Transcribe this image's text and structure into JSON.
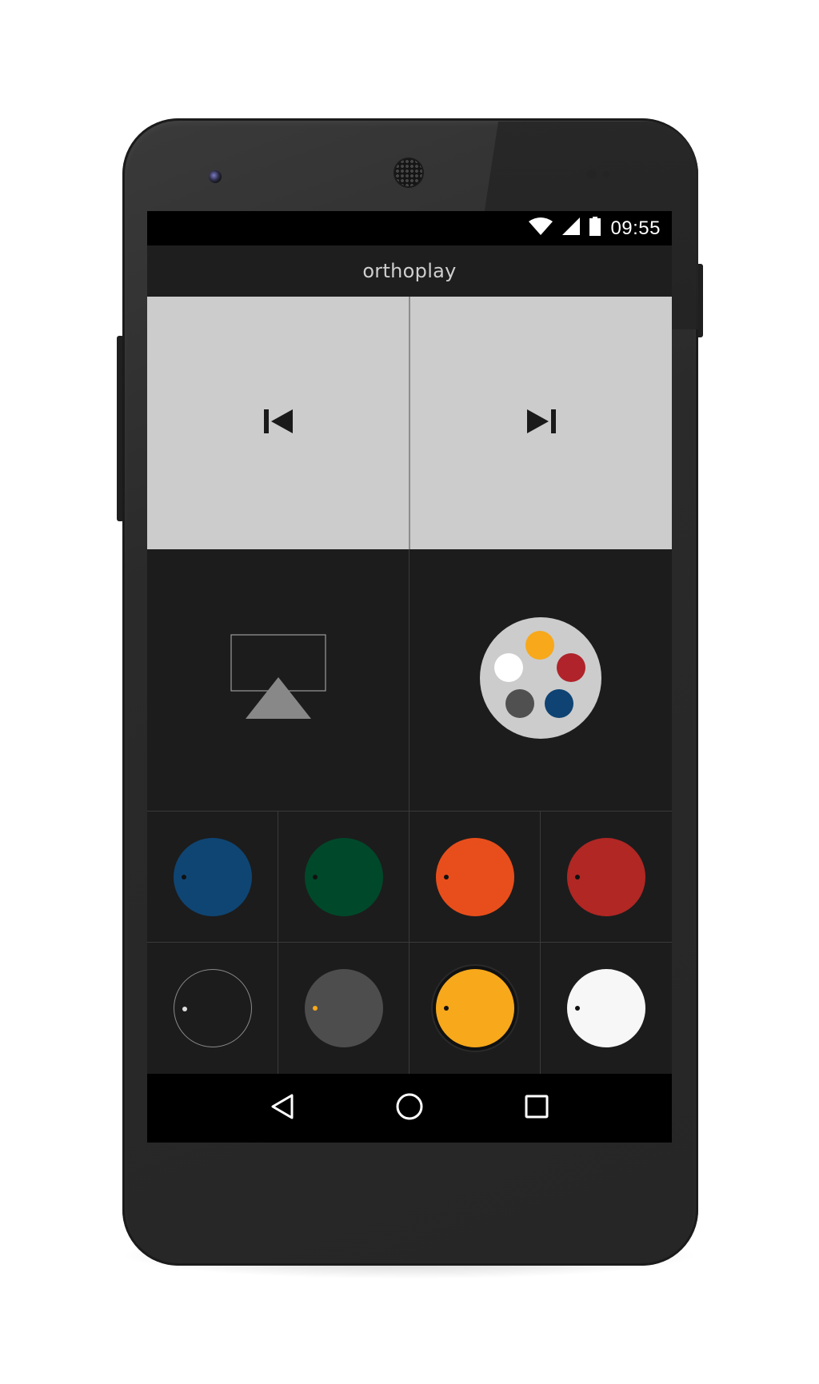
{
  "status_bar": {
    "time": "09:55",
    "icons": [
      "wifi-icon",
      "cell-signal-icon",
      "battery-icon"
    ]
  },
  "app": {
    "title": "orthoplay"
  },
  "media_controls": {
    "previous": {
      "icon": "skip-previous-icon"
    },
    "next": {
      "icon": "skip-next-icon"
    }
  },
  "actions": {
    "airplay": {
      "icon": "airplay-icon"
    },
    "palette": {
      "icon": "color-palette-icon",
      "colors": [
        "#F7A81B",
        "#FFFFFF",
        "#B0232A",
        "#505050",
        "#0E4373"
      ]
    }
  },
  "swatches": [
    {
      "color": "#0F4573",
      "dot": "#111111",
      "style": "filled",
      "selected": false
    },
    {
      "color": "#00482A",
      "dot": "#111111",
      "style": "filled",
      "selected": false
    },
    {
      "color": "#E84E1B",
      "dot": "#111111",
      "style": "filled",
      "selected": false
    },
    {
      "color": "#B02724",
      "dot": "#111111",
      "style": "filled",
      "selected": false
    },
    {
      "color": "#1C1C1C",
      "dot": "#DDDDDD",
      "style": "outline",
      "selected": false
    },
    {
      "color": "#4D4D4D",
      "dot": "#F7A81B",
      "style": "filled",
      "selected": false
    },
    {
      "color": "#F7A81B",
      "dot": "#111111",
      "style": "filled",
      "selected": true
    },
    {
      "color": "#F7F7F7",
      "dot": "#111111",
      "style": "filled",
      "selected": false
    }
  ],
  "nav_bar": {
    "back": "back-triangle-icon",
    "home": "home-circle-icon",
    "recents": "recents-square-icon"
  },
  "colors": {
    "screen_bg": "#1C1C1C",
    "media_bg": "#CCCCCC",
    "icon_dark": "#1A1A1A",
    "airplay_gray": "#888888"
  }
}
